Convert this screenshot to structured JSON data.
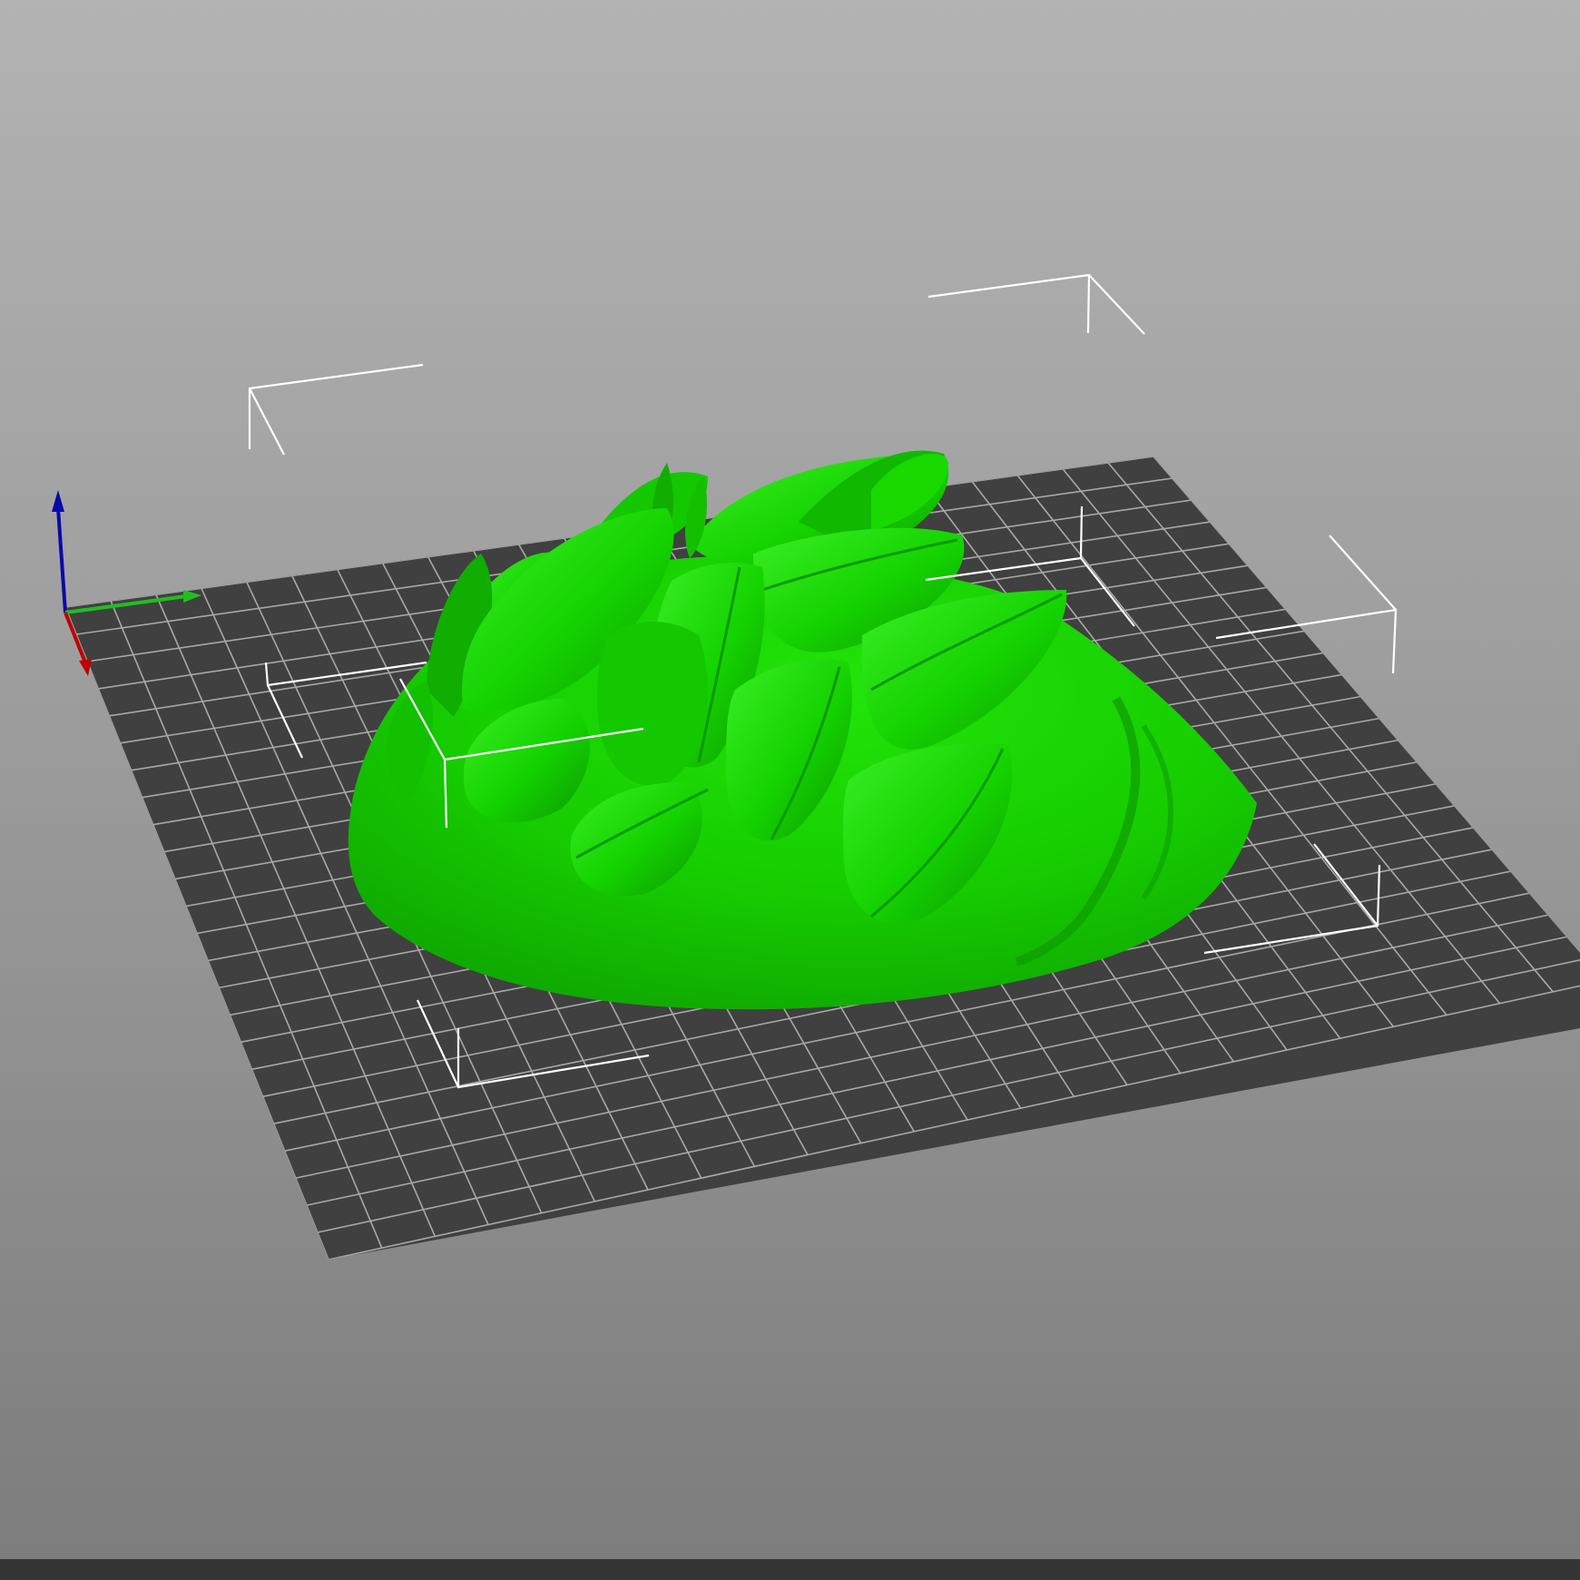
{
  "app": {
    "view": "3d-print-preview",
    "bed": {
      "grid_divisions": 24,
      "color": "#404040",
      "grid_color": "#a8a8a8"
    },
    "model": {
      "color": "#19d900",
      "shading": "#0fa800",
      "highlight": "#4cf23a"
    },
    "axes": {
      "x_color": "#c00000",
      "y_color": "#1fbf1f",
      "z_color": "#0a0aa8"
    },
    "selection_box_color": "#ffffff",
    "icons": [
      "axis-gizmo-icon"
    ]
  }
}
